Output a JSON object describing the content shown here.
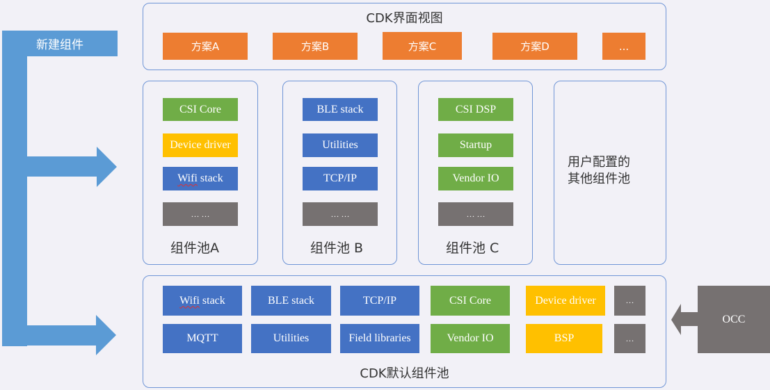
{
  "new_component": {
    "label": "新建组件",
    "color": "#5b9bd5"
  },
  "ui_view": {
    "title": "CDK界面视图",
    "plans": [
      "方案A",
      "方案B",
      "方案C",
      "方案D",
      "..."
    ]
  },
  "pools": [
    {
      "title": "组件池A",
      "items": [
        {
          "label": "CSI Core",
          "color": "green"
        },
        {
          "label": "Device driver",
          "color": "yellow"
        },
        {
          "label": "Wifi stack",
          "color": "blue",
          "spell_flag": true
        },
        {
          "label": "… …",
          "color": "gray"
        }
      ]
    },
    {
      "title": "组件池 B",
      "items": [
        {
          "label": "BLE stack",
          "color": "blue"
        },
        {
          "label": "Utilities",
          "color": "blue"
        },
        {
          "label": "TCP/IP",
          "color": "blue"
        },
        {
          "label": "… …",
          "color": "gray"
        }
      ]
    },
    {
      "title": "组件池 C",
      "items": [
        {
          "label": "CSI DSP",
          "color": "green"
        },
        {
          "label": "Startup",
          "color": "green"
        },
        {
          "label": "Vendor IO",
          "color": "green"
        },
        {
          "label": "… …",
          "color": "gray"
        }
      ]
    }
  ],
  "user_pool": {
    "line1": "用户配置的",
    "line2": "其他组件池"
  },
  "default_pool": {
    "title": "CDK默认组件池",
    "row1": [
      "Wifi stack",
      "BLE stack",
      "TCP/IP",
      "CSI Core",
      "Device driver",
      "…"
    ],
    "row2": [
      "MQTT",
      "Utilities",
      "Field libraries",
      "Vendor IO",
      "BSP",
      "…"
    ]
  },
  "occ": {
    "label": "OCC"
  },
  "colors": {
    "orange": "#ed7d31",
    "green": "#70ad47",
    "yellow": "#ffc000",
    "blue": "#4472c4",
    "gray": "#767171",
    "frame_border": "#6f95d6",
    "background": "#f2f1f7"
  }
}
